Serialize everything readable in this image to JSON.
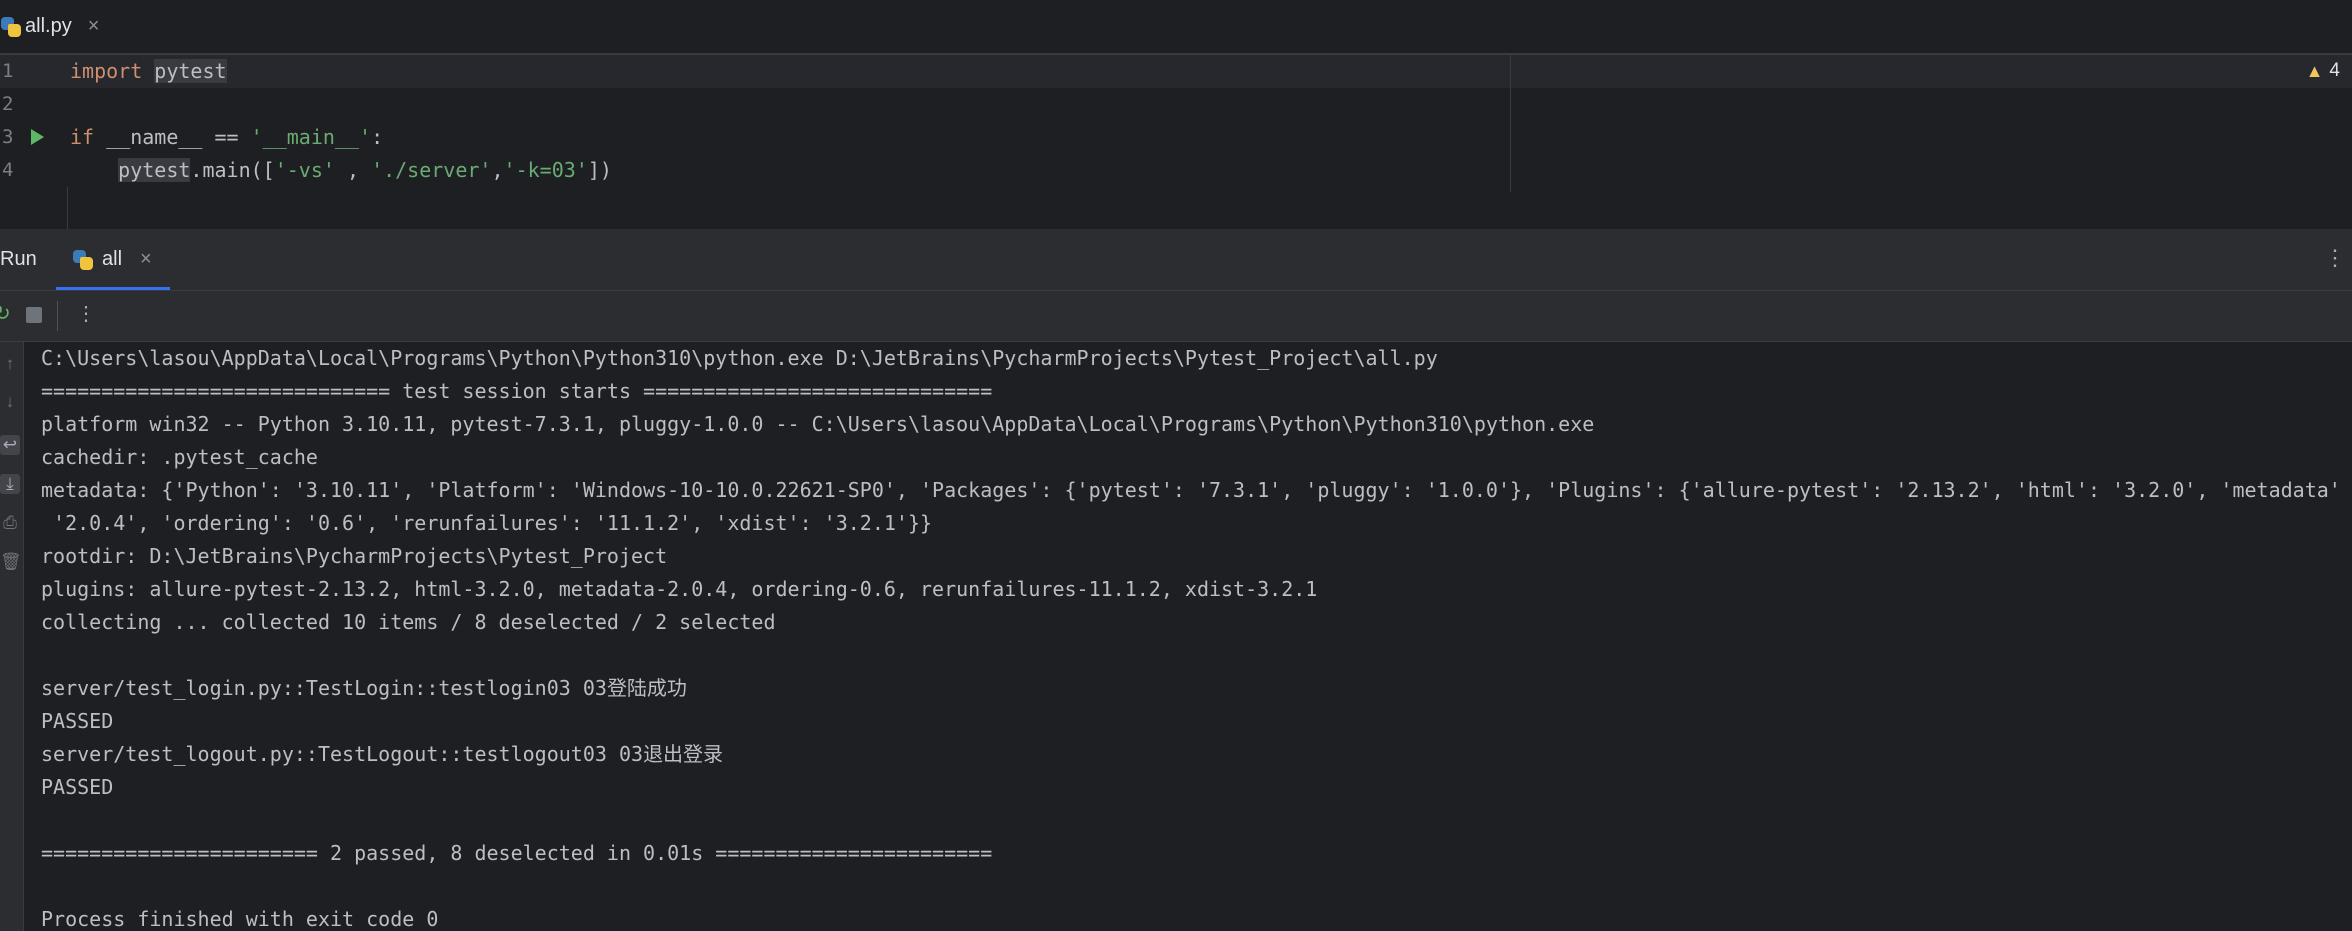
{
  "editor_tab": {
    "title": "all.py",
    "close": "×"
  },
  "code_lines": [
    {
      "n": "1",
      "tokens": [
        {
          "t": "import",
          "c": "kw"
        },
        {
          "t": " ",
          "c": ""
        },
        {
          "t": "pytest",
          "c": "ident hl"
        }
      ]
    },
    {
      "n": "2",
      "tokens": []
    },
    {
      "n": "3",
      "tokens": [
        {
          "t": "if",
          "c": "kw"
        },
        {
          "t": " __name__ == ",
          "c": ""
        },
        {
          "t": "'__main__'",
          "c": "str"
        },
        {
          "t": ":",
          "c": ""
        }
      ]
    },
    {
      "n": "4",
      "tokens": [
        {
          "t": "    ",
          "c": ""
        },
        {
          "t": "pytest",
          "c": "ident hl"
        },
        {
          "t": ".main([",
          "c": ""
        },
        {
          "t": "'-vs'",
          "c": "str"
        },
        {
          "t": " , ",
          "c": ""
        },
        {
          "t": "'./server'",
          "c": "str"
        },
        {
          "t": ",",
          "c": ""
        },
        {
          "t": "'-k=03'",
          "c": "str"
        },
        {
          "t": "])",
          "c": ""
        }
      ]
    }
  ],
  "inspection": {
    "count": "4",
    "icon": "warning-icon"
  },
  "run": {
    "label": "Run",
    "tab_label": "all",
    "tab_close": "×",
    "more": "⋮"
  },
  "toolbar": {
    "rerun": "↻",
    "more": "⋮"
  },
  "console_lines": [
    "C:\\Users\\lasou\\AppData\\Local\\Programs\\Python\\Python310\\python.exe D:\\JetBrains\\PycharmProjects\\Pytest_Project\\all.py",
    "============================= test session starts =============================",
    "platform win32 -- Python 3.10.11, pytest-7.3.1, pluggy-1.0.0 -- C:\\Users\\lasou\\AppData\\Local\\Programs\\Python\\Python310\\python.exe",
    "cachedir: .pytest_cache",
    "metadata: {'Python': '3.10.11', 'Platform': 'Windows-10-10.0.22621-SP0', 'Packages': {'pytest': '7.3.1', 'pluggy': '1.0.0'}, 'Plugins': {'allure-pytest': '2.13.2', 'html': '3.2.0', 'metadata':",
    " '2.0.4', 'ordering': '0.6', 'rerunfailures': '11.1.2', 'xdist': '3.2.1'}}",
    "rootdir: D:\\JetBrains\\PycharmProjects\\Pytest_Project",
    "plugins: allure-pytest-2.13.2, html-3.2.0, metadata-2.0.4, ordering-0.6, rerunfailures-11.1.2, xdist-3.2.1",
    "collecting ... collected 10 items / 8 deselected / 2 selected",
    "",
    "server/test_login.py::TestLogin::testlogin03 03登陆成功",
    "PASSED",
    "server/test_logout.py::TestLogout::testlogout03 03退出登录",
    "PASSED",
    "",
    "======================= 2 passed, 8 deselected in 0.01s =======================",
    "",
    "Process finished with exit code 0"
  ]
}
